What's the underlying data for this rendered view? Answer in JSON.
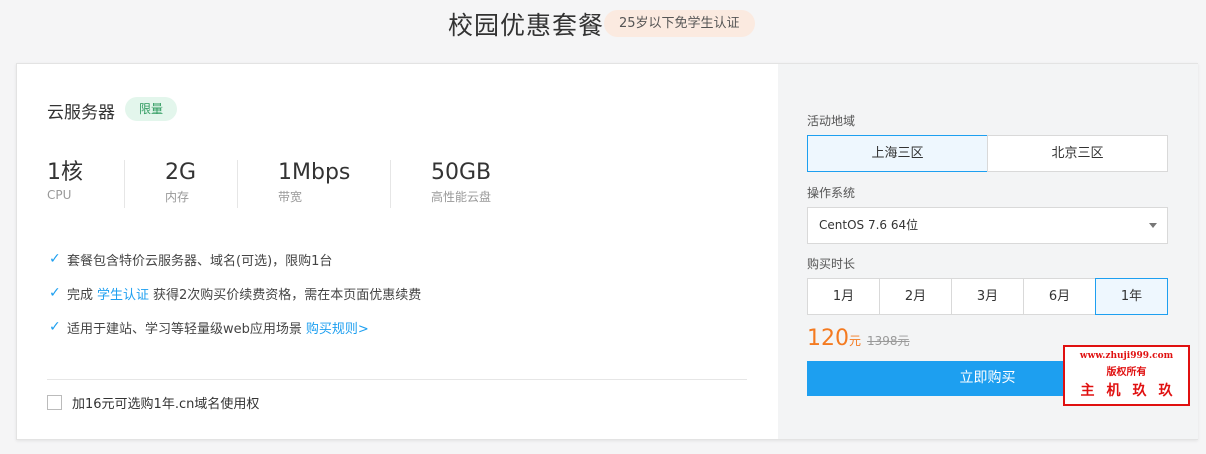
{
  "header": {
    "title": "校园优惠套餐",
    "badge": "25岁以下免学生认证"
  },
  "product": {
    "name": "云服务器",
    "badge": "限量",
    "specs": [
      {
        "value": "1核",
        "label": "CPU"
      },
      {
        "value": "2G",
        "label": "内存"
      },
      {
        "value": "1Mbps",
        "label": "带宽"
      },
      {
        "value": "50GB",
        "label": "高性能云盘"
      }
    ],
    "features": {
      "f1": "套餐包含特价云服务器、域名(可选)，限购1台",
      "f2_pre": "完成",
      "f2_link": "学生认证",
      "f2_post": "获得2次购买价续费资格，需在本页面优惠续费",
      "f3_pre": "适用于建站、学习等轻量级web应用场景",
      "f3_link": "购买规则>"
    },
    "domain_addon": "加16元可选购1年.cn域名使用权"
  },
  "order": {
    "region_label": "活动地域",
    "regions": [
      "上海三区",
      "北京三区"
    ],
    "selected_region": "上海三区",
    "os_label": "操作系统",
    "os_value": "CentOS 7.6 64位",
    "duration_label": "购买时长",
    "durations": [
      "1月",
      "2月",
      "3月",
      "6月",
      "1年"
    ],
    "selected_duration": "1年",
    "price": "120",
    "price_unit": "元",
    "original_price": "1398元",
    "buy_label": "立即购买"
  },
  "watermark": {
    "url": "www.zhuji999.com",
    "line2": "版权所有",
    "line3": "主机玖玖"
  },
  "colors": {
    "accent": "#1d9ff0",
    "price": "#f47a20",
    "badge_green": "#2d9a5e",
    "watermark": "#e01010"
  }
}
